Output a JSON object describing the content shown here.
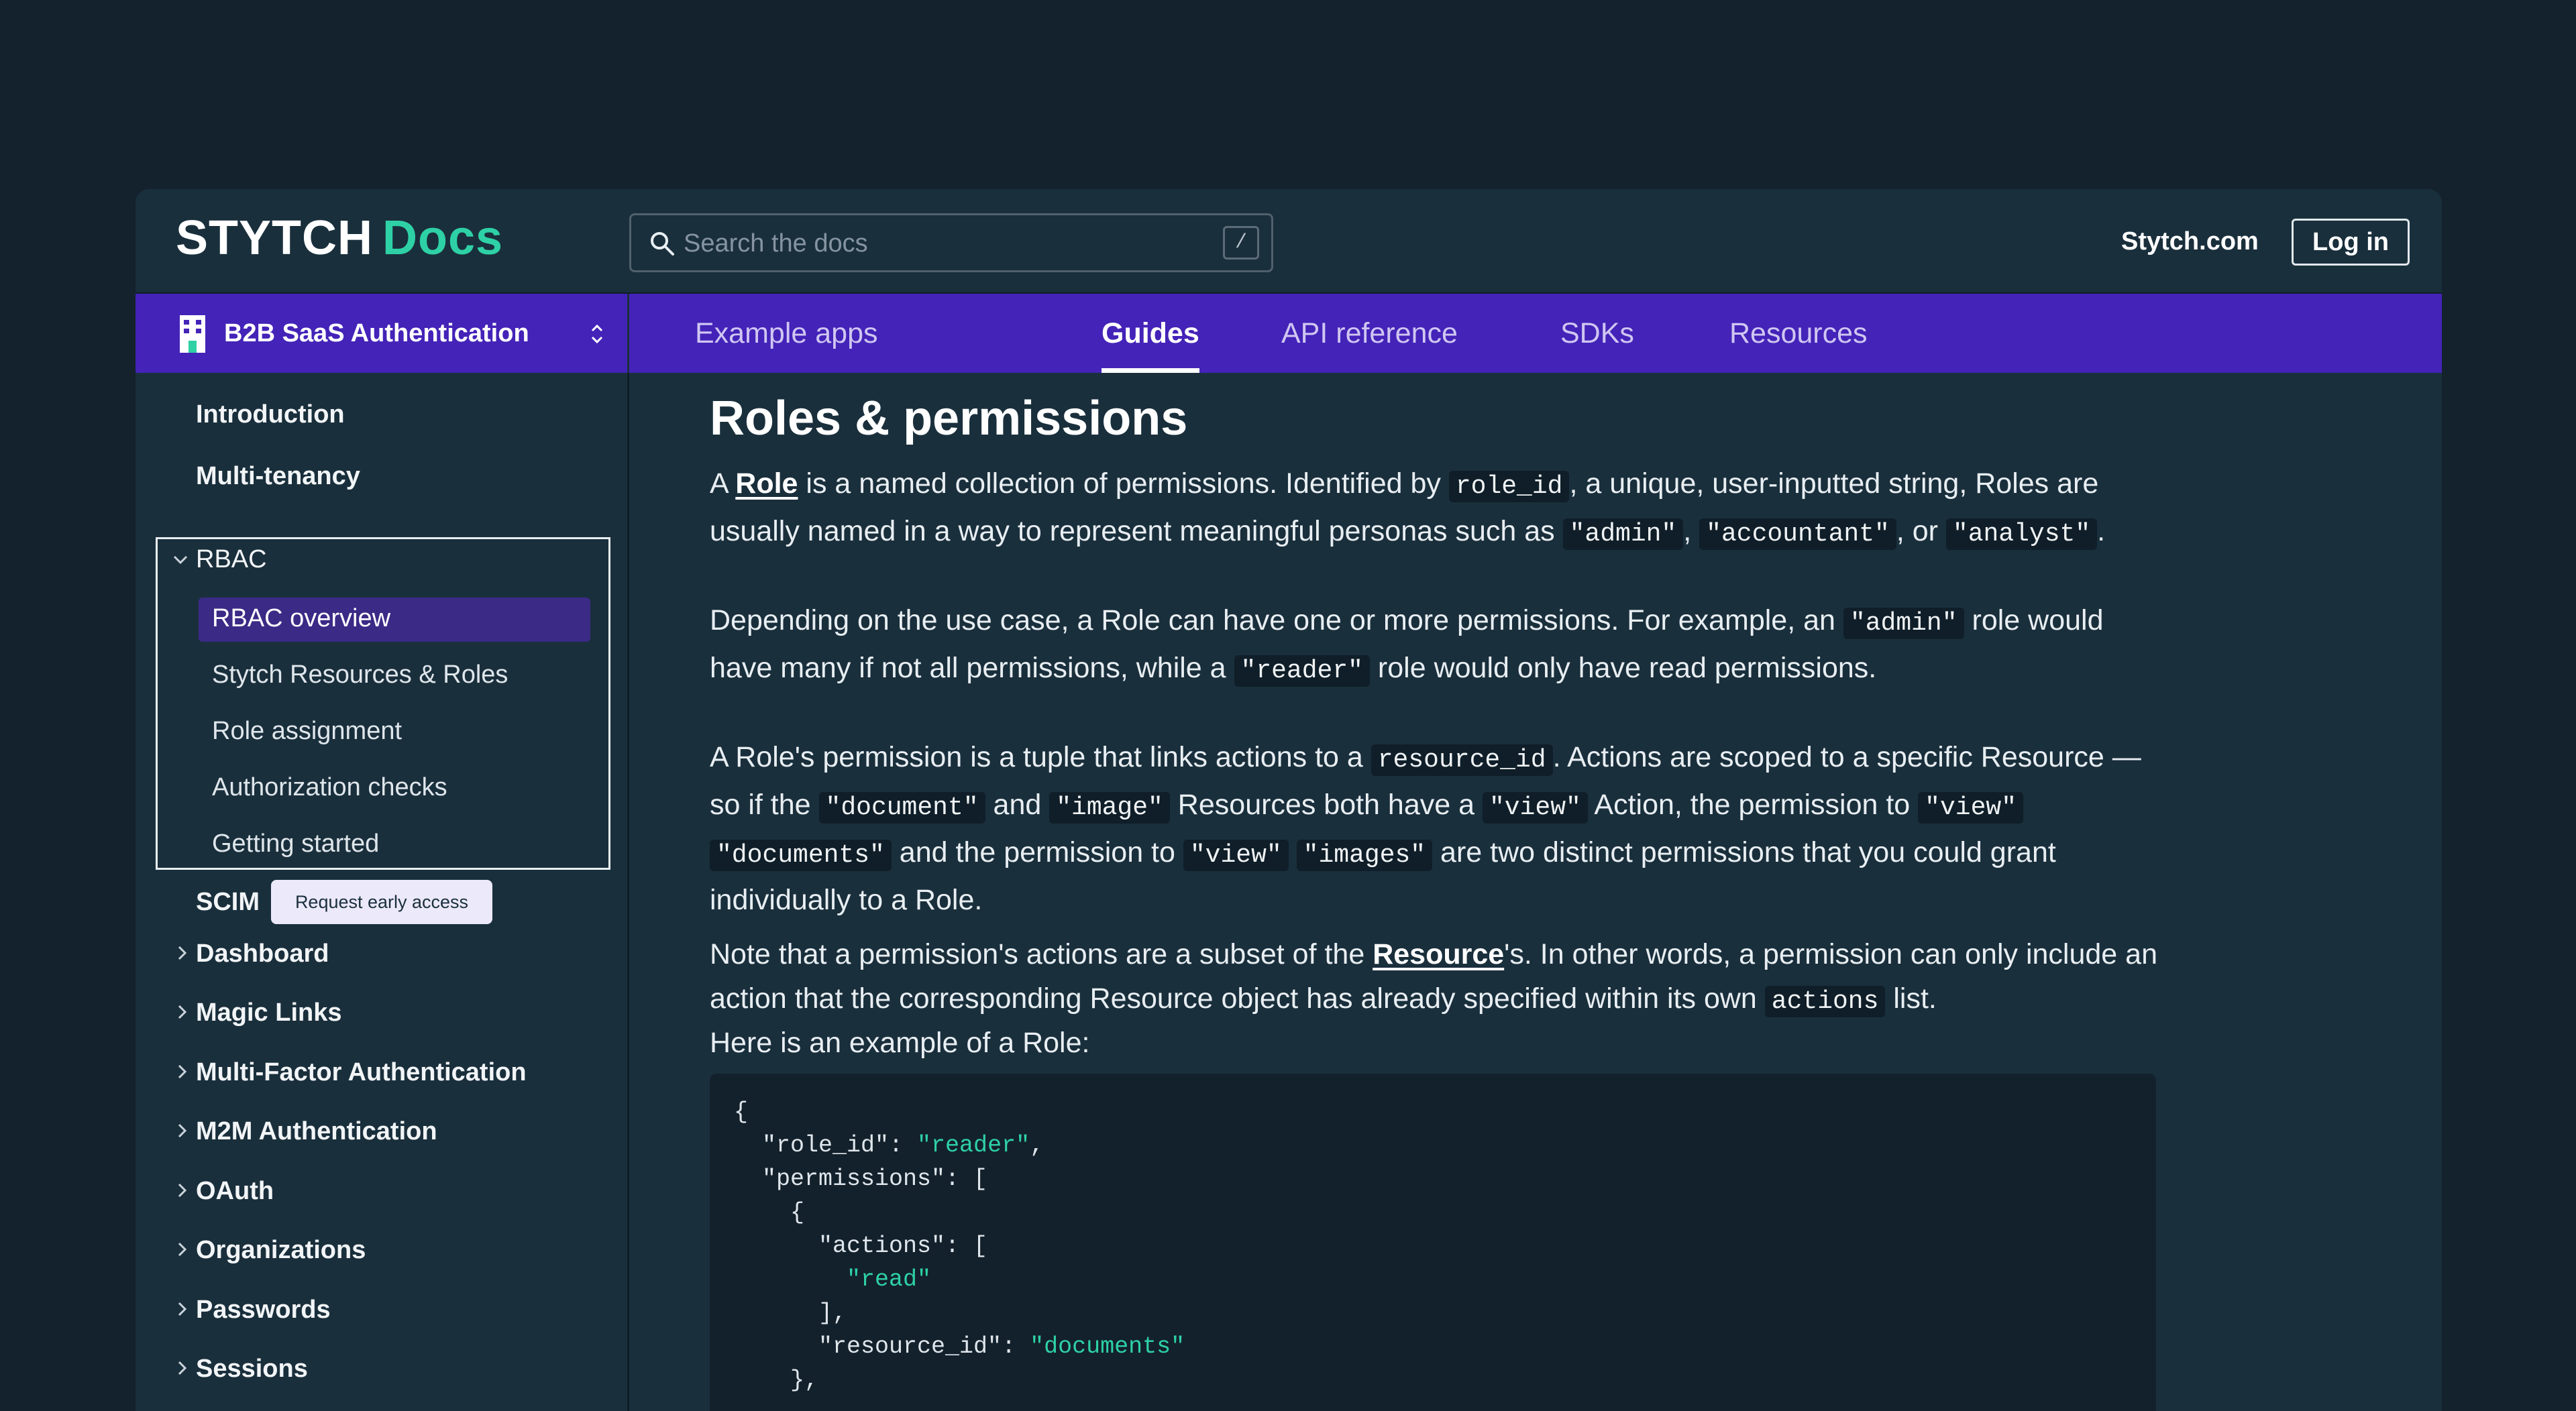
{
  "header": {
    "logo_brand": "STYTCH",
    "logo_docs": "Docs",
    "search_placeholder": "Search the docs",
    "search_shortcut": "/",
    "site_link": "Stytch.com",
    "login_label": "Log in"
  },
  "navbar": {
    "product_label": "B2B SaaS Authentication",
    "tabs": [
      "Example apps",
      "Guides",
      "API reference",
      "SDKs",
      "Resources"
    ],
    "active_tab": "Guides"
  },
  "sidebar": {
    "intro": "Introduction",
    "multi_tenancy": "Multi-tenancy",
    "rbac": "RBAC",
    "rbac_items": [
      "RBAC overview",
      "Stytch Resources & Roles",
      "Role assignment",
      "Authorization checks",
      "Getting started"
    ],
    "active_item": "RBAC overview",
    "scim": "SCIM",
    "scim_badge": "Request early access",
    "sections": [
      "Dashboard",
      "Magic Links",
      "Multi-Factor Authentication",
      "M2M Authentication",
      "OAuth",
      "Organizations",
      "Passwords",
      "Sessions"
    ]
  },
  "content": {
    "title": "Roles & permissions",
    "p1": {
      "t1": "A ",
      "link_role": "Role",
      "t2": " is a named collection of permissions. Identified by ",
      "c_role_id": "role_id",
      "t3": ", a unique, user-inputted string, Roles are usually named in a way to represent meaningful personas such as ",
      "c_admin": "\"admin\"",
      "t4": ", ",
      "c_accountant": "\"accountant\"",
      "t5": ", or ",
      "c_analyst": "\"analyst\"",
      "t6": "."
    },
    "p2": {
      "t1": "Depending on the use case, a Role can have one or more permissions. For example, an ",
      "c_admin": "\"admin\"",
      "t2": " role would have many if not all permissions, while a ",
      "c_reader": "\"reader\"",
      "t3": " role would only have read permissions."
    },
    "p3": {
      "t1": "A Role's permission is a tuple that links actions to a ",
      "c_resource_id": "resource_id",
      "t2": ". Actions are scoped to a specific Resource — so if the ",
      "c_document": "\"document\"",
      "t3": " and ",
      "c_image": "\"image\"",
      "t4": " Resources both have a ",
      "c_view": "\"view\"",
      "t5": " Action, the permission to ",
      "c_view2": "\"view\"",
      "t6": " ",
      "c_documents": "\"documents\"",
      "t7": " and the permission to ",
      "c_view3": "\"view\"",
      "t8": " ",
      "c_images": "\"images\"",
      "t9": " are two distinct permissions that you could grant individually to a Role."
    },
    "p4": {
      "t1": "Note that a permission's actions are a subset of the ",
      "link_resource": "Resource",
      "t2": "'s. In other words, a permission can only include an action that the corresponding Resource object has already specified within its own ",
      "c_actions": "actions",
      "t3": " list."
    },
    "p5": "Here is an example of a Role:",
    "code": {
      "l1": "{",
      "l2_key": "  \"role_id\": ",
      "l2_val": "\"reader\"",
      "l2_end": ",",
      "l3": "  \"permissions\": [",
      "l4": "    {",
      "l5": "      \"actions\": [",
      "l6_val": "        \"read\"",
      "l7": "      ],",
      "l8_key": "      \"resource_id\": ",
      "l8_val": "\"documents\"",
      "l9": "    },"
    }
  },
  "colors": {
    "background": "#13222d",
    "panel": "#1a2f3c",
    "navbar": "#4423b8",
    "accent_green": "#2ed1a6",
    "active_item": "#3b2a86"
  }
}
